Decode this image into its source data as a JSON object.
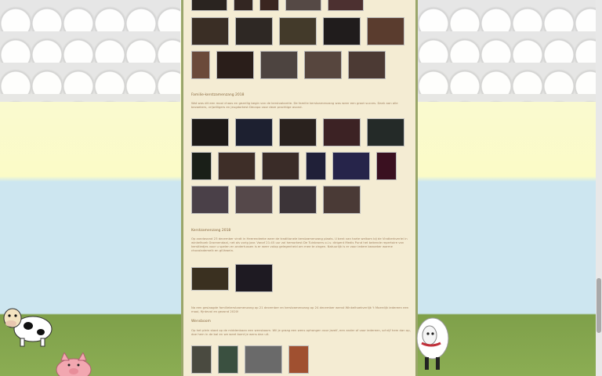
{
  "sections": {
    "family": {
      "heading": "Familie-kerstzamenzang 2018",
      "paragraph": "Wat was dit een mooi chaos en gezellig begin van de kerstvakantie. De familie kerstzamenzang was weer een groot succes. Dank aan alle bezoekers, vrijwilligers en jeugdorkest Decapo voor deze prachtige avond."
    },
    "kerst": {
      "heading": "Kerstzamenzang 2018",
      "paragraph": "Op zondavond 23 december vindt in Heerendeeke weer de traditionele kerstzamenzang plaats. U bent van harte welkom bij de Vindkerkverlei in winkelhoek Groenendaal, net als vorig jaar. Vanaf 21:45 uur zal hemorkest De Tuinbroers o.l.v. dirigent Medis Pund het bekende repertoire van kerstliedjes voor u spelen en ondertussen is er weer volop gelegenheid om mee te zingen. Natuurlijk is er voor iedere bezoeker warme chocolademelk en glühwein."
    },
    "note": {
      "paragraph": "Na een geslaagde familiekerstzamenzang op 21 december en kerstzamenzang op 24 december wenst Winkelhoekverlijk 't Moerdijk iedereen een mooi, fijntevol en gezond 2020!"
    },
    "wens": {
      "heading": "Wensboom",
      "paragraph": "Op het plein staat op de middenbaan een wensboom. Wil je graag een wens ophangen voor jezelf, een ander of voor iedereen, schrijf hem dan op, doe hem in de bal en we weet komt je wens dan uit."
    }
  },
  "colors": {
    "content_bg": "#f4ecd3",
    "border": "#9aa66a",
    "heading": "#8a6a40"
  }
}
